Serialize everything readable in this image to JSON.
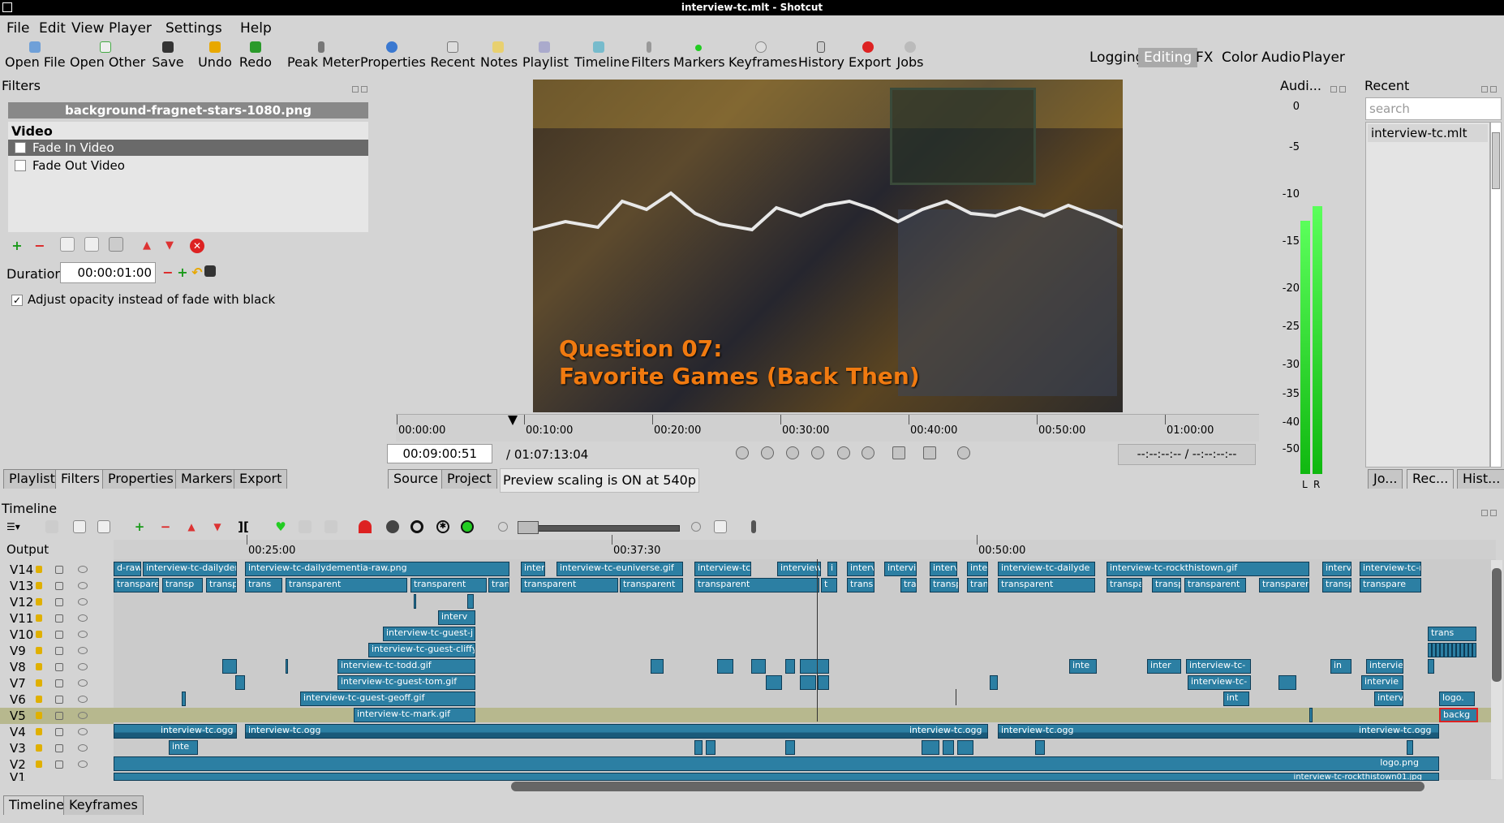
{
  "window": {
    "title": "interview-tc.mlt - Shotcut"
  },
  "menu": [
    "File",
    "Edit",
    "View",
    "Player",
    "Settings",
    "Help"
  ],
  "toolbar": {
    "buttons": [
      {
        "label": "Open File",
        "icon": "open-file-icon"
      },
      {
        "label": "Open Other",
        "icon": "open-other-icon"
      },
      {
        "label": "Save",
        "icon": "save-icon"
      },
      {
        "label": "Undo",
        "icon": "undo-icon"
      },
      {
        "label": "Redo",
        "icon": "redo-icon"
      },
      {
        "label": "Peak Meter",
        "icon": "peak-meter-icon"
      },
      {
        "label": "Properties",
        "icon": "properties-icon"
      },
      {
        "label": "Recent",
        "icon": "recent-icon"
      },
      {
        "label": "Notes",
        "icon": "notes-icon"
      },
      {
        "label": "Playlist",
        "icon": "playlist-icon"
      },
      {
        "label": "Timeline",
        "icon": "timeline-icon"
      },
      {
        "label": "Filters",
        "icon": "filters-icon"
      },
      {
        "label": "Markers",
        "icon": "markers-icon"
      },
      {
        "label": "Keyframes",
        "icon": "keyframes-icon"
      },
      {
        "label": "History",
        "icon": "history-icon"
      },
      {
        "label": "Export",
        "icon": "export-icon"
      },
      {
        "label": "Jobs",
        "icon": "jobs-icon"
      }
    ],
    "workspaces": [
      "Logging",
      "Editing",
      "FX",
      "Color",
      "Audio",
      "Player"
    ],
    "active_workspace": "Editing"
  },
  "filters": {
    "title": "Filters",
    "file": "background-fragnet-stars-1080.png",
    "section": "Video",
    "items": [
      {
        "label": "Fade In Video",
        "checked": true,
        "selected": true
      },
      {
        "label": "Fade Out Video",
        "checked": false,
        "selected": false
      }
    ],
    "duration_label": "Duration",
    "duration_value": "00:00:01:00",
    "opacity_label": "Adjust opacity instead of fade with black",
    "opacity_checked": true
  },
  "left_tabs": [
    "Playlist",
    "Filters",
    "Properties",
    "Markers",
    "Export"
  ],
  "player": {
    "overlay_line1": "Question 07:",
    "overlay_line2": "Favorite Games (Back Then)",
    "ruler_ticks": [
      "00:00:00",
      "00:10:00",
      "00:20:00",
      "00:30:00",
      "00:40:00",
      "00:50:00",
      "01:00:00"
    ],
    "timecode": "00:09:00:51",
    "total": "/ 01:07:13:04",
    "in_out": "--:--:--:-- / --:--:--:--",
    "tabs": [
      "Source",
      "Project"
    ],
    "scaling_message": "Preview scaling is ON at 540p"
  },
  "audio_meter": {
    "title": "Audi...",
    "scale": [
      "0",
      "-5",
      "-10",
      "-15",
      "-20",
      "-25",
      "-30",
      "-35",
      "-40",
      "-50"
    ],
    "left_label": "L",
    "right_label": "R",
    "left_level_db": -12,
    "right_level_db": -11
  },
  "recent": {
    "title": "Recent",
    "search_placeholder": "search",
    "items": [
      "interview-tc.mlt"
    ],
    "tabs": [
      "Jo...",
      "Rec...",
      "Hist..."
    ]
  },
  "timeline": {
    "title": "Timeline",
    "output_label": "Output",
    "ruler_ticks": [
      "00:25:00",
      "00:37:30",
      "00:50:00"
    ],
    "tracks": [
      "V14",
      "V13",
      "V12",
      "V11",
      "V10",
      "V9",
      "V8",
      "V7",
      "V6",
      "V5",
      "V4",
      "V3",
      "V2",
      "V1"
    ],
    "clips": {
      "v14a": "d-raw.",
      "v14b": "interview-tc-dailydem",
      "v14c": "interview-tc-dailydementia-raw.png",
      "v14d": "interv",
      "v14e": "interview-tc-euniverse.gif",
      "v14f": "interview-tc-r",
      "v14g": "interview-",
      "v14h": "i",
      "v14i": "interv",
      "v14j": "intervi",
      "v14k": "interv",
      "v14l": "inter",
      "v14m": "interview-tc-dailyde",
      "v14n": "interview-tc-rockthistown.gif",
      "v14o": "intervi",
      "v14p": "interview-tc-ro",
      "v13a": "transpare",
      "v13b": "transp",
      "v13c": "transp",
      "v13d": "trans",
      "v13e": "transparent",
      "v13f": "transparent",
      "v13g": "trans",
      "v13h": "transparent",
      "v13i": "transparent",
      "v13j": "transparent",
      "v13k": "t",
      "v13l": "transp",
      "v13m": "tra",
      "v13n": "transp",
      "v13o": "trans",
      "v13p": "transparent",
      "v13q": "transpa",
      "v13r": "transp",
      "v13s": "transparent",
      "v13t": "transparent",
      "v13u": "transp",
      "v13v": "transpare",
      "v11a": "interv",
      "v10a": "interview-tc-guest-j",
      "v10b": "trans",
      "v9a": "interview-tc-guest-cliffyb.gi",
      "v8a": "interview-tc-todd.gif",
      "v8b": "inte",
      "v8c": "inter",
      "v8d": "interview-tc-",
      "v8e": "in",
      "v8f": "interview",
      "v7a": "interview-tc-guest-tom.gif",
      "v7b": "interview-tc-",
      "v7c": "intervie",
      "v6a": "interview-tc-guest-geoff.gif",
      "v6b": "int",
      "v6c": "intervi",
      "v6d": "logo.",
      "v5a": "interview-tc-mark.gif",
      "v5b": "backg",
      "v4a": "interview-tc.ogg",
      "v4b": "interview-tc.ogg",
      "v4c": "interview-tc.ogg",
      "v4d": "interview-tc.ogg",
      "v4e": "interview-tc.ogg",
      "v3a": "inte",
      "v2a": "logo.png",
      "v1a": "interview-tc-rockthistown01.jpg"
    }
  },
  "bottom_tabs": [
    "Timeline",
    "Keyframes"
  ]
}
